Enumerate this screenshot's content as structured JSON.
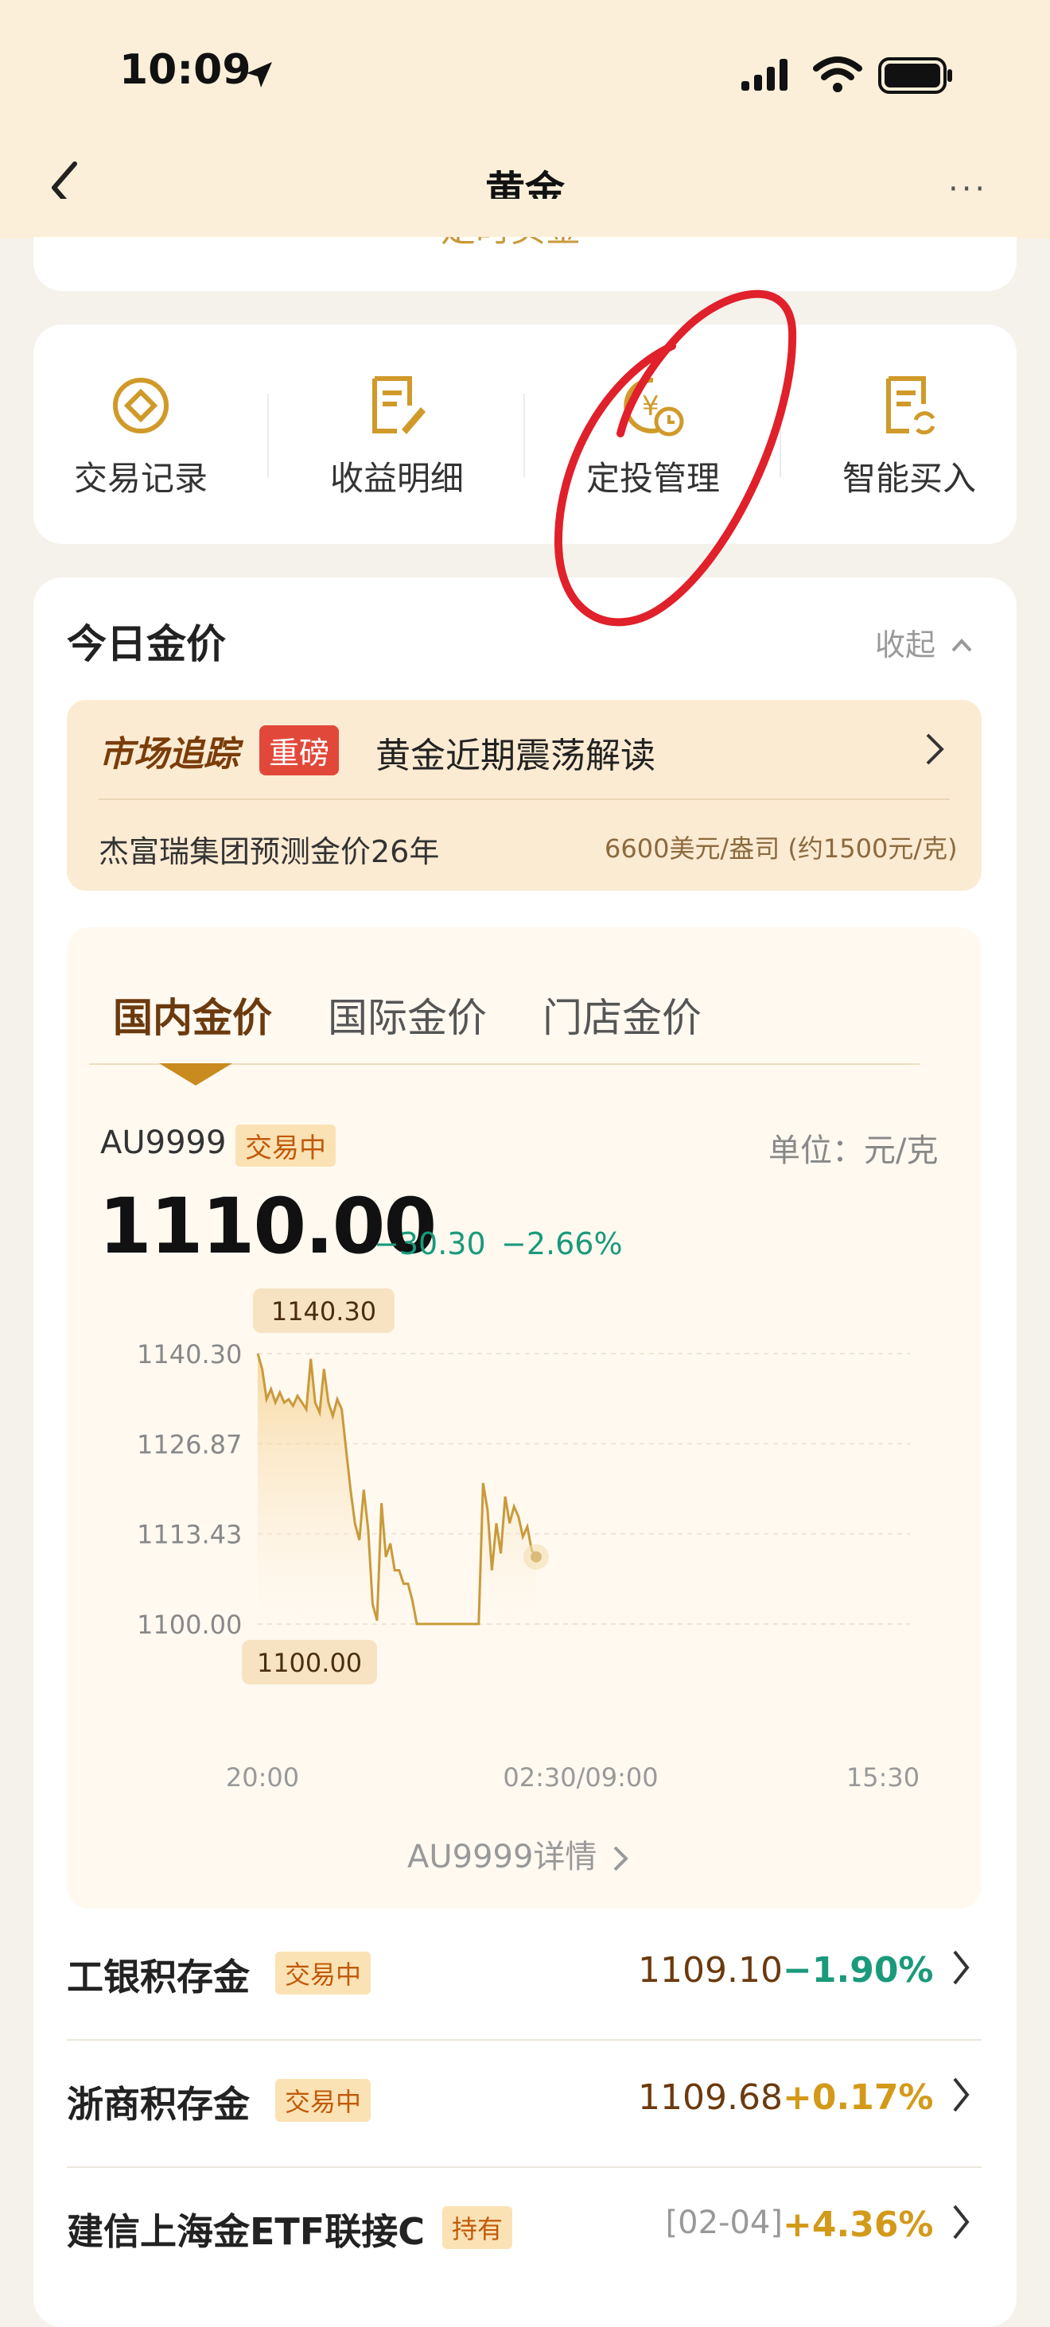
{
  "status": {
    "time": "10:09"
  },
  "nav": {
    "title": "黄金",
    "more": "···"
  },
  "top_link": "定时买金",
  "actions": [
    {
      "label": "交易记录",
      "icon": "circle-diamond-icon"
    },
    {
      "label": "收益明细",
      "icon": "document-pen-icon"
    },
    {
      "label": "定投管理",
      "icon": "yuan-clock-icon"
    },
    {
      "label": "智能买入",
      "icon": "document-refresh-icon"
    }
  ],
  "gold": {
    "title": "今日金价",
    "collapse": "收起",
    "market": {
      "brand": "市场追踪",
      "badge": "重磅",
      "headline": "黄金近期震荡解读",
      "forecast": "杰富瑞集团预测金价26年",
      "forecast_value": "6600美元/盎司 (约1500元/克)"
    },
    "tabs": [
      "国内金价",
      "国际金价",
      "门店金价"
    ],
    "symbol": "AU9999",
    "status_badge": "交易中",
    "unit": "单位：元/克",
    "price": "1110.00",
    "change": "−30.30",
    "change_pct": "−2.66%",
    "detail_link": "AU9999详情"
  },
  "chart_data": {
    "type": "line",
    "y_ticks": [
      "1140.30",
      "1126.87",
      "1113.43",
      "1100.00"
    ],
    "ylim": [
      1100.0,
      1140.3
    ],
    "x_ticks": [
      "20:00",
      "02:30/09:00",
      "15:30"
    ],
    "high_label": "1140.30",
    "low_label": "1100.00",
    "x": [
      0,
      1,
      2,
      3,
      4,
      5,
      6,
      7,
      8,
      9,
      10,
      11,
      12,
      13,
      14,
      15,
      16,
      17,
      18,
      19,
      20,
      21,
      22,
      23,
      24,
      25,
      26,
      27,
      28,
      29,
      30,
      31,
      32,
      33,
      34,
      35,
      36,
      37,
      38,
      39,
      40,
      41,
      42,
      43,
      44,
      45,
      46,
      47,
      48,
      49,
      50,
      51,
      52,
      53,
      54,
      55,
      56,
      57,
      58,
      59,
      60,
      61,
      62,
      63
    ],
    "series": [
      {
        "values": [
          1140.3,
          1138.0,
          1133.5,
          1135.0,
          1133.0,
          1134.5,
          1133.0,
          1133.5,
          1132.5,
          1134.0,
          1133.0,
          1132.0,
          1139.5,
          1133.0,
          1131.5,
          1138.0,
          1133.0,
          1131.0,
          1133.5,
          1132.0,
          1126.0,
          1120.0,
          1115.0,
          1112.5,
          1120.0,
          1114.0,
          1103.0,
          1100.5,
          1118.0,
          1110.0,
          1112.0,
          1108.0,
          1108.0,
          1106.0,
          1106.0,
          1103.5,
          1100.0,
          1100.0,
          1100.0,
          1100.0,
          1100.0,
          1100.0,
          1100.0,
          1100.0,
          1100.0,
          1100.0,
          1100.0,
          1100.0,
          1100.0,
          1100.0,
          1100.0,
          1121.0,
          1117.0,
          1108.0,
          1115.0,
          1110.5,
          1119.0,
          1115.0,
          1117.5,
          1116.0,
          1113.0,
          1114.5,
          1111.0,
          1110.0
        ]
      }
    ],
    "line_color": "#C99A3A"
  },
  "list": [
    {
      "name": "工银积存金",
      "tag": "交易中",
      "value": "1109.10",
      "pct": "−1.90%",
      "pct_color": "#1A9A7A"
    },
    {
      "name": "浙商积存金",
      "tag": "交易中",
      "value": "1109.68",
      "pct": "+0.17%",
      "pct_color": "#D39A1A"
    },
    {
      "name": "建信上海金ETF联接C",
      "tag": "持有",
      "value": "[02-04]",
      "pct": "+4.36%",
      "pct_color": "#D39A1A"
    }
  ],
  "annotation": {
    "color": "#E0202A"
  }
}
